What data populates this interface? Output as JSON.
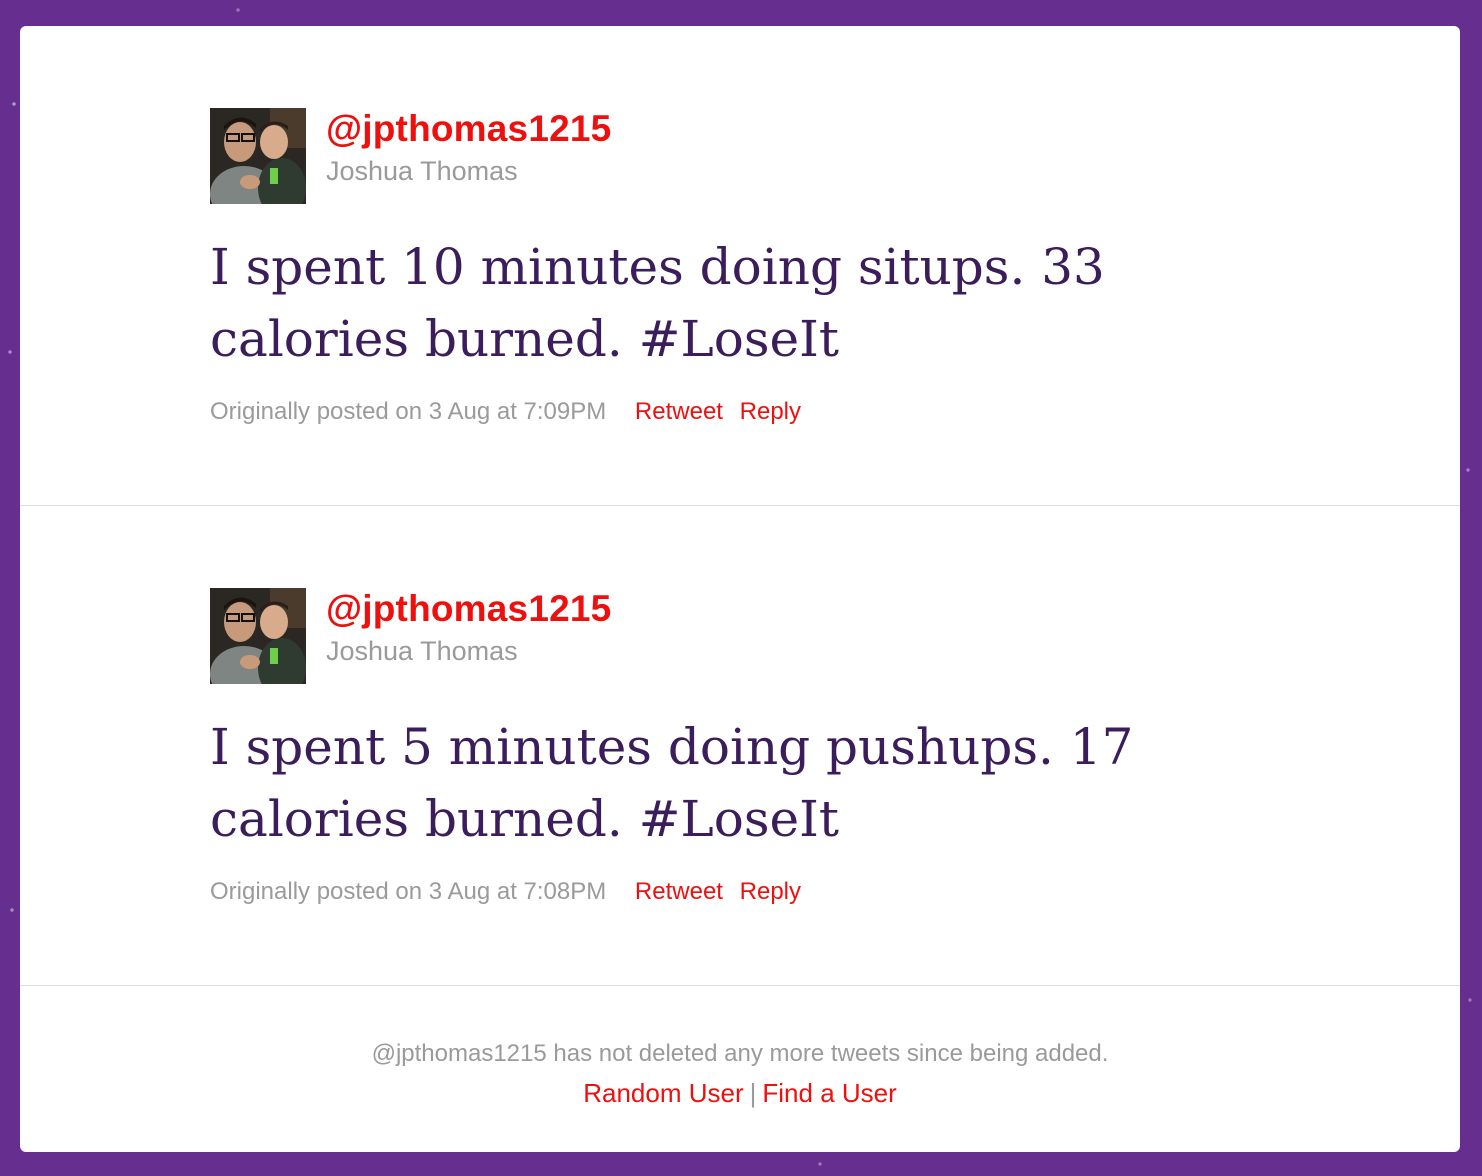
{
  "colors": {
    "background": "#652e8f",
    "card": "#ffffff",
    "link": "#ee0f0f",
    "tweet_text": "#3a1d5a",
    "muted": "#9a9a9a"
  },
  "tweets": [
    {
      "handle": "@jpthomas1215",
      "name": "Joshua Thomas",
      "avatar_icon": "user-avatar-photo",
      "text": "I spent 10 minutes doing situps. 33 calories burned. #LoseIt",
      "posted": "Originally posted on 3 Aug at 7:09PM",
      "retweet_label": "Retweet",
      "reply_label": "Reply"
    },
    {
      "handle": "@jpthomas1215",
      "name": "Joshua Thomas",
      "avatar_icon": "user-avatar-photo",
      "text": "I spent 5 minutes doing pushups. 17 calories burned. #LoseIt",
      "posted": "Originally posted on 3 Aug at 7:08PM",
      "retweet_label": "Retweet",
      "reply_label": "Reply"
    }
  ],
  "footer": {
    "message": "@jpthomas1215 has not deleted any more tweets since being added.",
    "random_user_label": "Random User",
    "separator": "|",
    "find_user_label": "Find a User"
  }
}
